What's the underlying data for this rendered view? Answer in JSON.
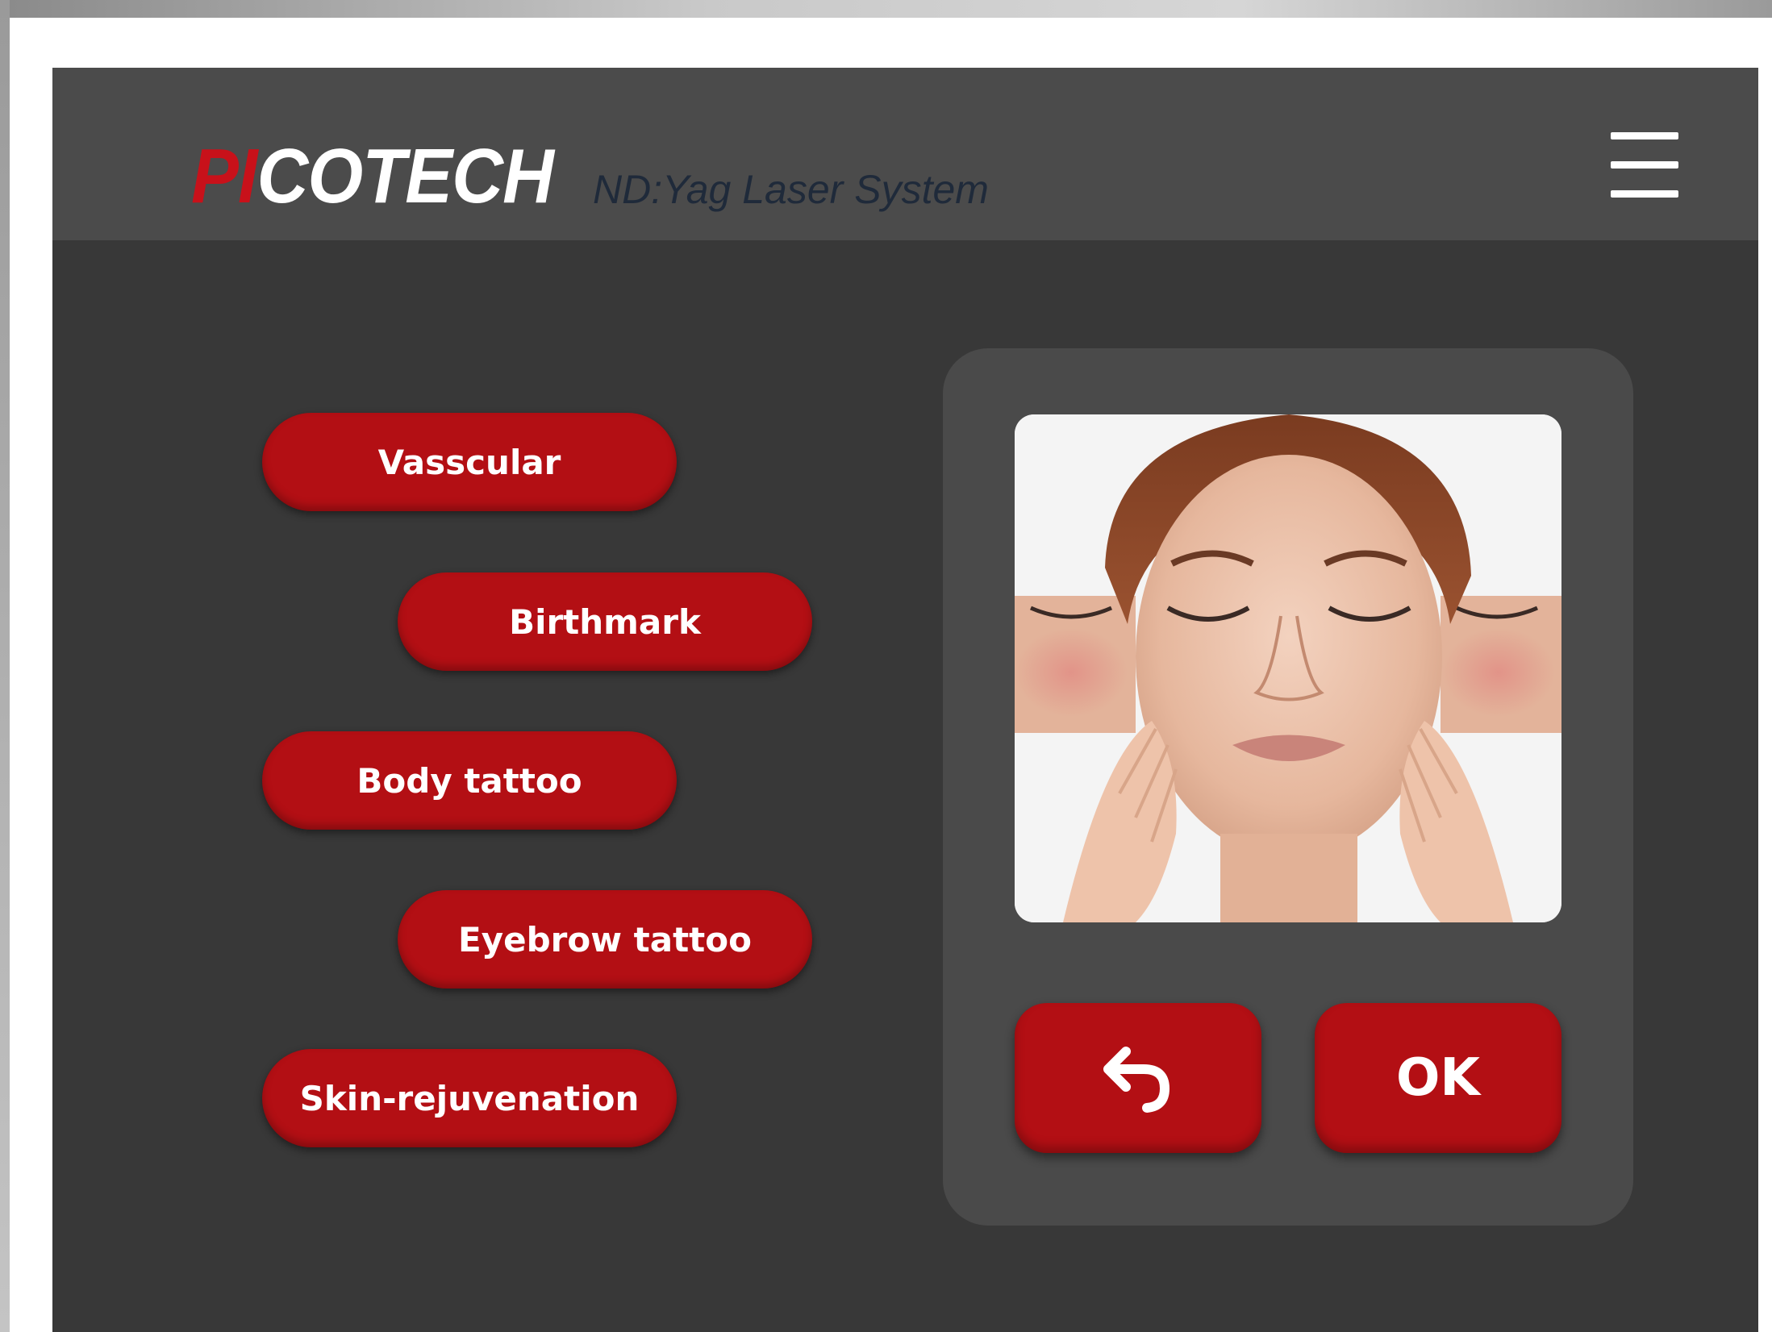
{
  "header": {
    "brand_prefix": "PI",
    "brand_rest": "COTECH",
    "subtitle": "ND:Yag Laser System",
    "menu_icon": "hamburger-menu-icon"
  },
  "treatments": [
    {
      "label": "Vasscular"
    },
    {
      "label": "Birthmark"
    },
    {
      "label": "Body tattoo"
    },
    {
      "label": "Eyebrow tattoo"
    },
    {
      "label": "Skin-rejuvenation"
    }
  ],
  "preview": {
    "image": "face-skin-treatment-photo"
  },
  "actions": {
    "back_icon": "undo-arrow-icon",
    "ok_label": "OK"
  },
  "colors": {
    "accent": "#b30f14",
    "screen_bg": "#383838",
    "header_bg": "#4b4b4b",
    "panel_bg": "#4a4a4a",
    "subtitle": "#1f2a3a"
  }
}
